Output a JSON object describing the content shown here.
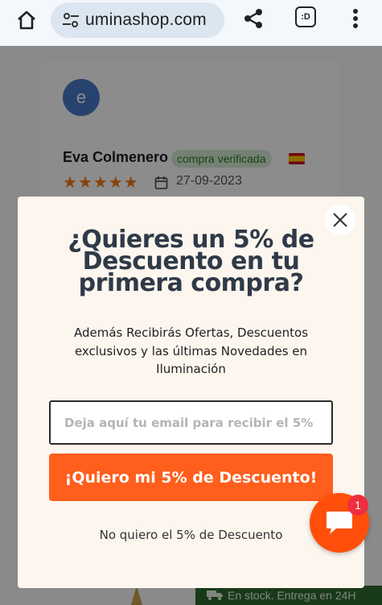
{
  "browser": {
    "url": "uminashop.com",
    "tab_icon_label": ":D"
  },
  "review": {
    "avatar_letter": "e",
    "reviewer_name": "Eva Colmenero",
    "verified_label": "compra verificada",
    "rating": 5,
    "stars": [
      "★",
      "★",
      "★",
      "★",
      "★"
    ],
    "date": "27-09-2023"
  },
  "stock_bar": {
    "text": "En stock. Entrega en 24H"
  },
  "popup": {
    "headline_line1": "¿Quieres un 5% de",
    "headline_line2": "Descuento en tu",
    "headline_line3": "primera compra?",
    "subtext": "Además Recibirás Ofertas, Descuentos exclusivos y las últimas Novedades en Iluminación",
    "email_placeholder": "Deja aquí tu email para recibir el 5%",
    "cta_label": "¡Quiero mi 5% de Descuento!",
    "decline_label": "No quiero el 5% de Descuento"
  },
  "chat": {
    "badge_count": "1"
  },
  "colors": {
    "accent": "#ff5e1c",
    "headline": "#2f3a48",
    "popup_bg": "#fdf6ef",
    "star": "#f07a1b"
  }
}
